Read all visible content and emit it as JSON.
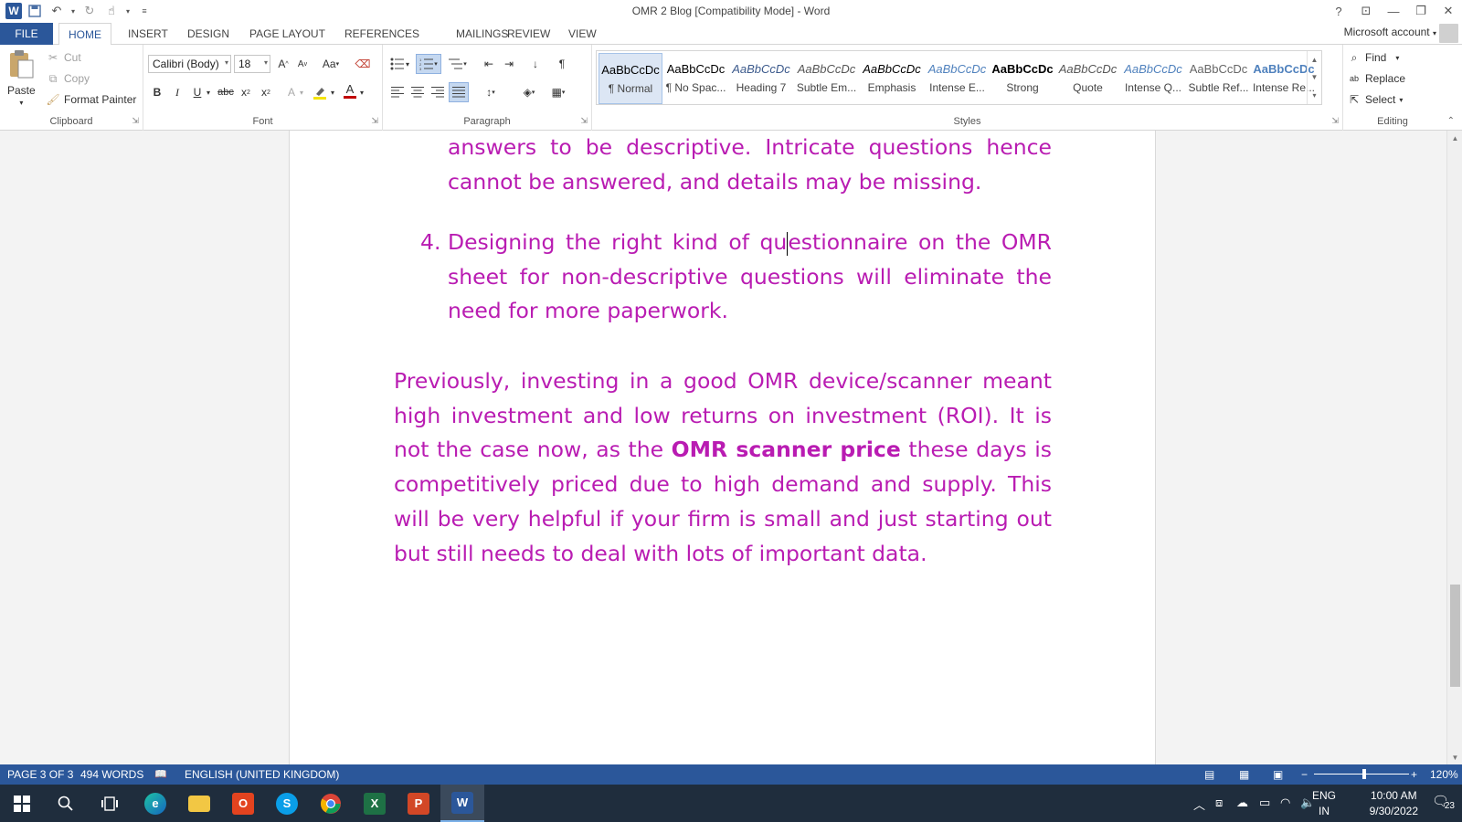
{
  "window": {
    "title": "OMR 2 Blog [Compatibility Mode] - Word",
    "controls": [
      "?",
      "⊡",
      "—",
      "❐",
      "✕"
    ]
  },
  "quick_access": {
    "icons": [
      "word-logo",
      "save-icon",
      "undo-icon",
      "redo-icon",
      "touch-mode-icon",
      "customize-icon"
    ]
  },
  "tabs": {
    "file": "FILE",
    "items": [
      "HOME",
      "INSERT",
      "DESIGN",
      "PAGE LAYOUT",
      "REFERENCES",
      "MAILINGS",
      "REVIEW",
      "VIEW"
    ],
    "active": "HOME"
  },
  "account": {
    "label": "Microsoft account"
  },
  "ribbon": {
    "clipboard": {
      "label": "Clipboard",
      "paste": "Paste",
      "cut": "Cut",
      "copy": "Copy",
      "format_painter": "Format Painter"
    },
    "font": {
      "label": "Font",
      "font_name": "Calibri (Body)",
      "font_size": "18",
      "highlight_color": "#f5e400",
      "font_color": "#c00000"
    },
    "paragraph": {
      "label": "Paragraph"
    },
    "styles": {
      "label": "Styles",
      "items": [
        {
          "preview": "AaBbCcDc",
          "name": "¶ Normal",
          "color": "#000000",
          "italic": false,
          "bold": false
        },
        {
          "preview": "AaBbCcDc",
          "name": "¶ No Spac...",
          "color": "#000000",
          "italic": false,
          "bold": false
        },
        {
          "preview": "AaBbCcDc",
          "name": "Heading 7",
          "color": "#3c5a8c",
          "italic": true,
          "bold": false
        },
        {
          "preview": "AaBbCcDc",
          "name": "Subtle Em...",
          "color": "#555555",
          "italic": true,
          "bold": false
        },
        {
          "preview": "AaBbCcDc",
          "name": "Emphasis",
          "color": "#000000",
          "italic": true,
          "bold": false
        },
        {
          "preview": "AaBbCcDc",
          "name": "Intense E...",
          "color": "#4f81bd",
          "italic": true,
          "bold": false
        },
        {
          "preview": "AaBbCcDc",
          "name": "Strong",
          "color": "#000000",
          "italic": false,
          "bold": true
        },
        {
          "preview": "AaBbCcDc",
          "name": "Quote",
          "color": "#555555",
          "italic": true,
          "bold": false
        },
        {
          "preview": "AaBbCcDc",
          "name": "Intense Q...",
          "color": "#4f81bd",
          "italic": true,
          "bold": false
        },
        {
          "preview": "AaBbCcDc",
          "name": "Subtle Ref...",
          "color": "#666666",
          "italic": false,
          "bold": false
        },
        {
          "preview": "AaBbCcDc",
          "name": "Intense Re...",
          "color": "#4f81bd",
          "italic": false,
          "bold": true
        }
      ]
    },
    "editing": {
      "label": "Editing",
      "find": "Find",
      "replace": "Replace",
      "select": "Select"
    }
  },
  "document": {
    "text_color": "#b91cb2",
    "top_paragraph_lines": [
      "answers to be descriptive. Intricate questions hence",
      "cannot be answered, and details may be missing."
    ],
    "item4": {
      "number": "4.",
      "text_before_cursor": "Designing the right kind of qu",
      "text_after_cursor": "estionnaire on the OMR sheet for non-descriptive questions will eliminate the need for more paperwork."
    },
    "previous_paragraph": {
      "before_bold": "Previously, investing in a good OMR device/scanner meant high investment and low returns on investment (ROI). It is not the case now, as the ",
      "bold": "OMR scanner price",
      "after_bold": " these days is competitively priced due to high demand and supply. This will be very helpful if your firm is small and just starting out but still needs to deal with lots of important data."
    }
  },
  "statusbar": {
    "page": "PAGE 3 OF 3",
    "words": "494 WORDS",
    "language": "ENGLISH (UNITED KINGDOM)",
    "zoom": "120%",
    "zoom_value": 120
  },
  "taskbar": {
    "apps": [
      "start-icon",
      "search-icon",
      "task-view-icon",
      "edge-icon",
      "file-explorer-icon",
      "office-icon",
      "skype-icon",
      "chrome-icon",
      "excel-icon",
      "powerpoint-icon",
      "word-icon"
    ],
    "lang_line1": "ENG",
    "lang_line2": "IN",
    "time": "10:00 AM",
    "date": "9/30/2022",
    "notifications": "23"
  }
}
